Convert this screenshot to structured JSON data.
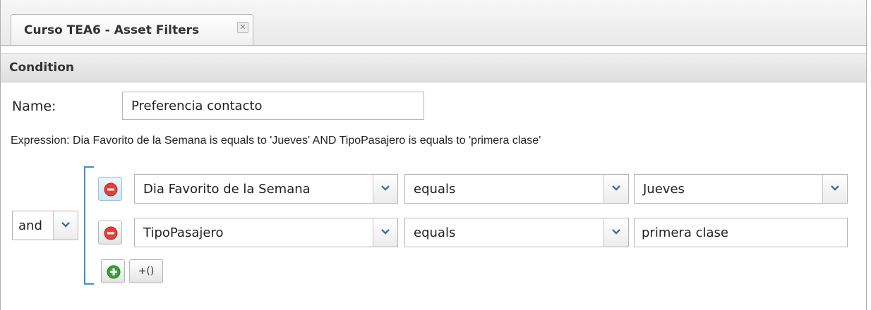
{
  "tab": {
    "title": "Curso TEA6 - Asset Filters",
    "close_glyph": "✕"
  },
  "panel": {
    "title": "Condition"
  },
  "form": {
    "name_label": "Name:",
    "name_value": "Preferencia contacto",
    "expression": "Expression: Dia Favorito de la Semana is equals to 'Jueves' AND TipoPasajero is equals to 'primera clase'"
  },
  "group": {
    "operator": "and"
  },
  "conditions": [
    {
      "field": "Dia Favorito de la Semana",
      "operator": "equals",
      "value": "Jueves",
      "value_type": "select"
    },
    {
      "field": "TipoPasajero",
      "operator": "equals",
      "value": "primera clase",
      "value_type": "text"
    }
  ],
  "buttons": {
    "add_group": "+()"
  },
  "colors": {
    "remove": "#e0403a",
    "add": "#3aa03a",
    "bracket": "#3d8fd0"
  },
  "icons": {
    "remove": "remove-condition-icon",
    "add": "add-condition-icon",
    "dropdown": "chevron-down-icon",
    "close": "close-tab-icon"
  }
}
